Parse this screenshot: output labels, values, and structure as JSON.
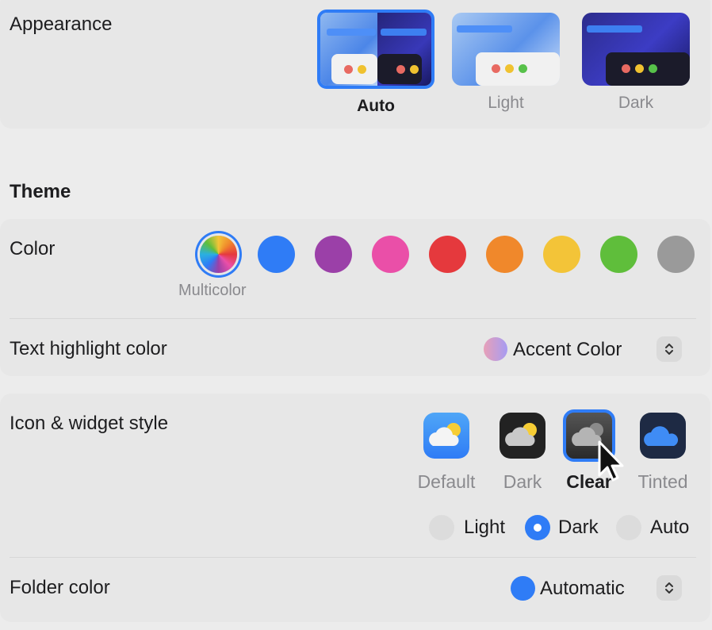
{
  "appearance": {
    "label": "Appearance",
    "options": [
      {
        "label": "Auto",
        "selected": true
      },
      {
        "label": "Light",
        "selected": false
      },
      {
        "label": "Dark",
        "selected": false
      }
    ]
  },
  "theme": {
    "heading": "Theme",
    "color_label": "Color",
    "selected_color_caption": "Multicolor",
    "swatches": [
      {
        "name": "multicolor",
        "color": "conic"
      },
      {
        "name": "blue",
        "color": "#2f7cf6"
      },
      {
        "name": "purple",
        "color": "#9b40a8"
      },
      {
        "name": "pink",
        "color": "#ea4fa8"
      },
      {
        "name": "red",
        "color": "#e5393d"
      },
      {
        "name": "orange",
        "color": "#f0882b"
      },
      {
        "name": "yellow",
        "color": "#f3c438"
      },
      {
        "name": "green",
        "color": "#5fbe3b"
      },
      {
        "name": "graphite",
        "color": "#9a9a9a"
      }
    ],
    "highlight_label": "Text highlight color",
    "highlight_value": "Accent Color"
  },
  "icon_widget": {
    "label": "Icon & widget style",
    "options": [
      {
        "label": "Default",
        "selected": false
      },
      {
        "label": "Dark",
        "selected": false
      },
      {
        "label": "Clear",
        "selected": true
      },
      {
        "label": "Tinted",
        "selected": false
      }
    ],
    "modes": [
      {
        "label": "Light",
        "selected": false
      },
      {
        "label": "Dark",
        "selected": true
      },
      {
        "label": "Auto",
        "selected": false
      }
    ]
  },
  "folder": {
    "label": "Folder color",
    "value": "Automatic"
  },
  "colors": {
    "accent": "#2f7cf6"
  }
}
